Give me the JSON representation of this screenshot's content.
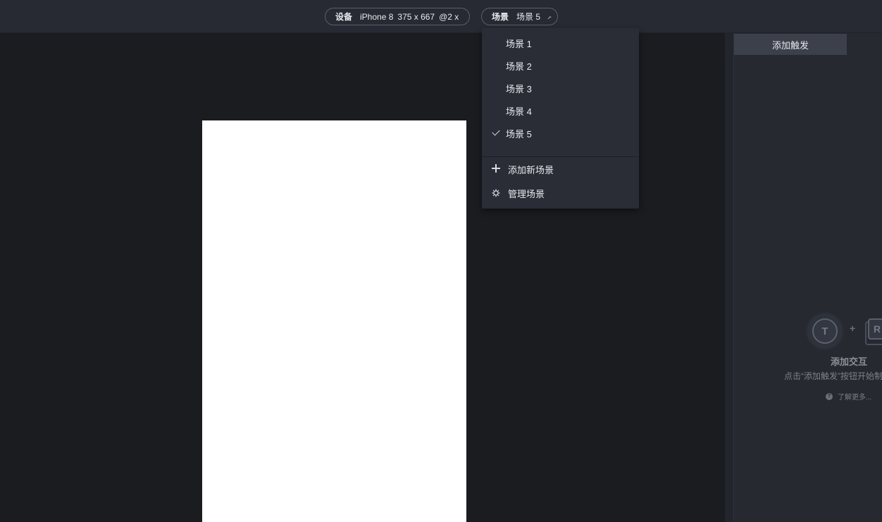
{
  "topbar": {
    "device": {
      "label": "设备",
      "model": "iPhone 8",
      "size": "375 x 667",
      "scale": "@2 x"
    },
    "scene": {
      "label": "场景",
      "current": "场景 5"
    }
  },
  "scene_menu": {
    "items": [
      {
        "label": "场景 1",
        "selected": false
      },
      {
        "label": "场景 2",
        "selected": false
      },
      {
        "label": "场景 3",
        "selected": false
      },
      {
        "label": "场景 4",
        "selected": false
      },
      {
        "label": "场景 5",
        "selected": true
      }
    ],
    "add_label": "添加新场景",
    "manage_label": "管理场景"
  },
  "right_panel": {
    "add_trigger_label": "添加触发",
    "illus_t": "T",
    "illus_plus": "+",
    "illus_r": "R",
    "empty_title": "添加交互",
    "empty_desc": "点击“添加触发”按钮开始制作",
    "learn_more": "了解更多...",
    "help_glyph": "?"
  },
  "colors": {
    "background": "#1a1c20",
    "topbar": "#272a33",
    "dropdown": "#2a2d36",
    "canvas": "#ffffff",
    "panel": "#262930"
  }
}
